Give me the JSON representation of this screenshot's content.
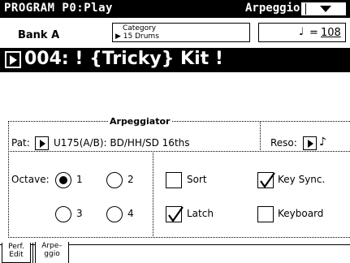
{
  "header": {
    "title": "PROGRAM P0:Play",
    "mode": "Arpeggio"
  },
  "bank": {
    "label": "Bank A"
  },
  "category": {
    "label": "Category",
    "value": "▶ 15 Drums"
  },
  "tempo": {
    "note_glyph": "♩",
    "equals": "=",
    "value": "108"
  },
  "program": {
    "name": "004: ! {Tricky} Kit !"
  },
  "arpeggiator": {
    "title": "Arpeggiator",
    "pattern_label": "Pat:",
    "pattern_value": "U175(A/B): BD/HH/SD 16ths",
    "reso_label": "Reso:",
    "reso_note": "♪",
    "octave_label": "Octave:",
    "octave_options": [
      "1",
      "2",
      "3",
      "4"
    ],
    "octave_selected": "1",
    "sort_label": "Sort",
    "sort_checked": false,
    "key_sync_label": "Key Sync.",
    "key_sync_checked": true,
    "latch_label": "Latch",
    "latch_checked": true,
    "keyboard_label": "Keyboard",
    "keyboard_checked": false
  },
  "tabs": [
    {
      "line1": "Perf.",
      "line2": "Edit",
      "active": false
    },
    {
      "line1": "Arpe–",
      "line2": "ggio",
      "active": true
    }
  ]
}
